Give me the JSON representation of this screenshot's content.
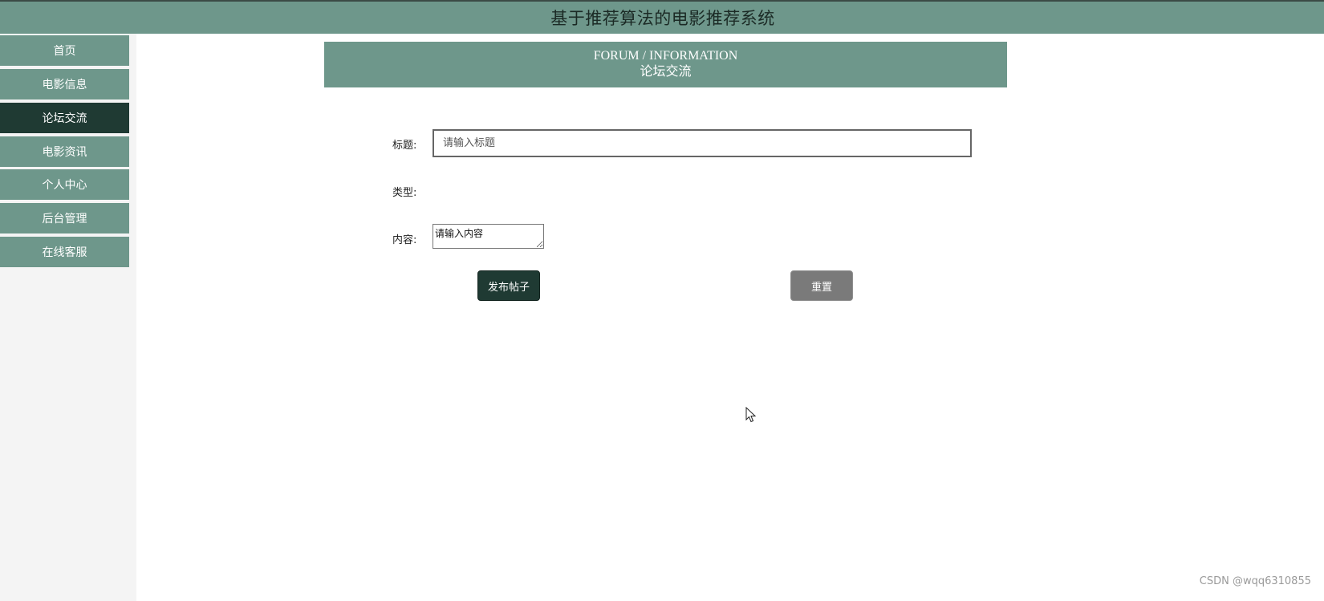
{
  "header": {
    "title": "基于推荐算法的电影推荐系统"
  },
  "sidebar": {
    "items": [
      {
        "label": "首页",
        "active": false
      },
      {
        "label": "电影信息",
        "active": false
      },
      {
        "label": "论坛交流",
        "active": true
      },
      {
        "label": "电影资讯",
        "active": false
      },
      {
        "label": "个人中心",
        "active": false
      },
      {
        "label": "后台管理",
        "active": false
      },
      {
        "label": "在线客服",
        "active": false
      }
    ]
  },
  "banner": {
    "title_en": "FORUM / INFORMATION",
    "title_cn": "论坛交流"
  },
  "form": {
    "title_label": "标题:",
    "title_placeholder": "请输入标题",
    "type_label": "类型:",
    "content_label": "内容:",
    "content_placeholder": "请输入内容",
    "publish_label": "发布帖子",
    "reset_label": "重置"
  },
  "watermark": "CSDN @wqq6310855",
  "colors": {
    "primary": "#6e978b",
    "active": "#1f3a33",
    "reset": "#7a7a7a",
    "sidebar_bg": "#f4f4f4"
  }
}
